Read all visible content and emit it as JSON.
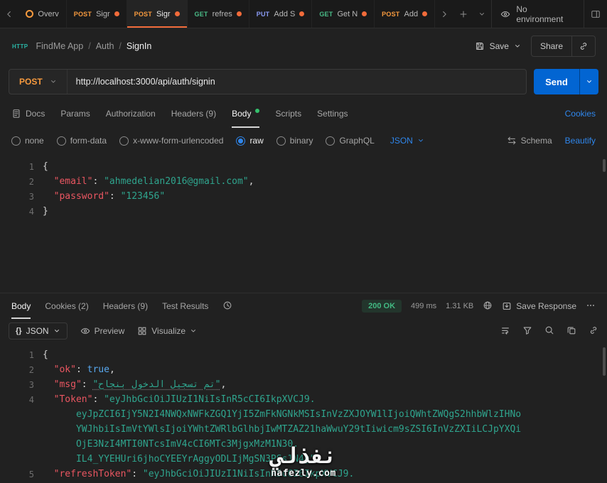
{
  "colors": {
    "accent_orange": "#f26b3a",
    "link_blue": "#2f86eb",
    "send_blue": "#0265d2",
    "method_post": "#f79a3e",
    "method_get": "#49bb87",
    "method_put": "#8a9bf5",
    "status_green": "#42ba83",
    "json_key": "#ea5661",
    "json_string": "#2fa58e",
    "json_boolean": "#59a9f0"
  },
  "topbar": {
    "tabs": [
      {
        "method": "",
        "label": "Overv",
        "dirty": false,
        "icon": "overview",
        "active": false
      },
      {
        "method": "POST",
        "label": "Sigr",
        "dirty": true,
        "active": false
      },
      {
        "method": "POST",
        "label": "Sigr",
        "dirty": true,
        "active": true
      },
      {
        "method": "GET",
        "label": "refres",
        "dirty": true,
        "active": false
      },
      {
        "method": "PUT",
        "label": "Add S",
        "dirty": true,
        "active": false
      },
      {
        "method": "GET",
        "label": "Get N",
        "dirty": true,
        "active": false
      },
      {
        "method": "POST",
        "label": "Add",
        "dirty": true,
        "active": false
      }
    ],
    "environment_label": "No environment"
  },
  "breadcrumb": {
    "badge": "HTTP",
    "app": "FindMe App",
    "separator": "/",
    "folder": "Auth",
    "request": "SignIn"
  },
  "actions": {
    "save": "Save",
    "share": "Share"
  },
  "request": {
    "method": "POST",
    "url": "http://localhost:3000/api/auth/signin",
    "send": "Send"
  },
  "req_tabs": {
    "docs": "Docs",
    "params": "Params",
    "authorization": "Authorization",
    "headers": "Headers (9)",
    "body": "Body",
    "scripts": "Scripts",
    "settings": "Settings",
    "cookies": "Cookies"
  },
  "body_modes": {
    "none": "none",
    "form_data": "form-data",
    "urlencoded": "x-www-form-urlencoded",
    "raw": "raw",
    "binary": "binary",
    "graphql": "GraphQL",
    "language": "JSON",
    "schema": "Schema",
    "beautify": "Beautify"
  },
  "request_body": {
    "lines": [
      {
        "n": "1",
        "tokens": [
          {
            "c": "p",
            "t": "{"
          }
        ]
      },
      {
        "n": "2",
        "tokens": [
          {
            "c": "k",
            "t": "  \"email\""
          },
          {
            "c": "p",
            "t": ": "
          },
          {
            "c": "s",
            "t": "\"ahmedelian2016@gmail.com\""
          },
          {
            "c": "p",
            "t": ","
          }
        ]
      },
      {
        "n": "3",
        "tokens": [
          {
            "c": "k",
            "t": "  \"password\""
          },
          {
            "c": "p",
            "t": ": "
          },
          {
            "c": "s",
            "t": "\"123456\""
          }
        ]
      },
      {
        "n": "4",
        "tokens": [
          {
            "c": "p",
            "t": "}"
          }
        ]
      }
    ]
  },
  "response": {
    "tabs": {
      "body": "Body",
      "cookies": "Cookies (2)",
      "headers": "Headers (9)",
      "tests": "Test Results"
    },
    "status": "200 OK",
    "time": "499 ms",
    "size": "1.31 KB",
    "save_response": "Save Response",
    "format_icon": "{}",
    "format_label": "JSON",
    "preview": "Preview",
    "visualize": "Visualize"
  },
  "response_body": {
    "lines": [
      {
        "n": "1",
        "tokens": [
          {
            "c": "p",
            "t": "{"
          }
        ]
      },
      {
        "n": "2",
        "tokens": [
          {
            "c": "k",
            "t": "  \"ok\""
          },
          {
            "c": "p",
            "t": ": "
          },
          {
            "c": "b",
            "t": "true"
          },
          {
            "c": "p",
            "t": ","
          }
        ]
      },
      {
        "n": "3",
        "tokens": [
          {
            "c": "k",
            "t": "  \"msg\""
          },
          {
            "c": "p",
            "t": ": "
          },
          {
            "c": "sh",
            "t": "\"تم تسجيل الدخول بنجاح\""
          },
          {
            "c": "p",
            "t": ","
          }
        ]
      },
      {
        "n": "4",
        "tokens": [
          {
            "c": "k",
            "t": "  \"Token\""
          },
          {
            "c": "p",
            "t": ": "
          },
          {
            "c": "s",
            "t": "\"eyJhbGciOiJIUzI1NiIsInR5cCI6IkpXVCJ9."
          }
        ]
      },
      {
        "n": "",
        "tokens": [
          {
            "c": "s",
            "t": "      eyJpZCI6IjY5N2I4NWQxNWFkZGQ1YjI5ZmFkNGNkMSIsInVzZXJOYW1lIjoiQWhtZWQgS2hhbWlzIHNo"
          }
        ]
      },
      {
        "n": "",
        "tokens": [
          {
            "c": "s",
            "t": "      YWJhbiIsImVtYWlsIjoiYWhtZWRlbGlhbjIwMTZAZ21haWwuY29tIiwicm9sZSI6InVzZXIiLCJpYXQi"
          }
        ]
      },
      {
        "n": "",
        "tokens": [
          {
            "c": "s",
            "t": "      OjE3NzI4MTI0NTcsImV4cCI6MTc3MjgxMzM1N30."
          }
        ]
      },
      {
        "n": "",
        "tokens": [
          {
            "c": "s",
            "t": "      IL4_YYEHUri6jhoCYEEYrAggyODLIjMgSN3PSs1N4g\""
          },
          {
            "c": "p",
            "t": ","
          }
        ]
      },
      {
        "n": "5",
        "tokens": [
          {
            "c": "k",
            "t": "  \"refreshToken\""
          },
          {
            "c": "p",
            "t": ": "
          },
          {
            "c": "s",
            "t": "\"eyJhbGciOiJIUzI1NiIsInR5cCI6IkpXVCJ9."
          }
        ]
      }
    ]
  },
  "watermark": {
    "title": "نفذلي",
    "domain": "nafezly.com"
  }
}
